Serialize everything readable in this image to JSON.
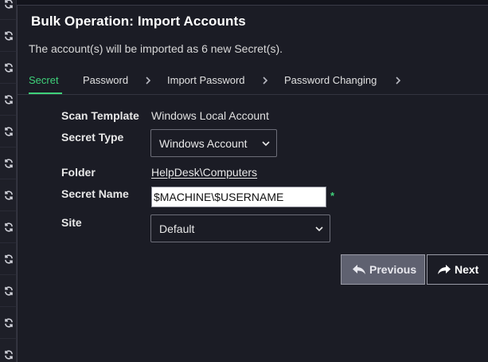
{
  "dialog": {
    "title": "Bulk Operation: Import Accounts",
    "subtitle": "The account(s) will be imported as 6 new Secret(s)."
  },
  "tabs": [
    {
      "label": "Secret",
      "active": true
    },
    {
      "label": "Password",
      "active": false
    },
    {
      "label": "Import Password",
      "active": false
    },
    {
      "label": "Password Changing",
      "active": false
    }
  ],
  "form": {
    "scan_template": {
      "label": "Scan Template",
      "value": "Windows Local Account"
    },
    "secret_type": {
      "label": "Secret Type",
      "selected": "Windows Account"
    },
    "folder": {
      "label": "Folder",
      "value": "HelpDesk\\Computers"
    },
    "secret_name": {
      "label": "Secret Name",
      "value": "$MACHINE\\$USERNAME",
      "required_marker": "*"
    },
    "site": {
      "label": "Site",
      "selected": "Default"
    }
  },
  "buttons": {
    "previous_label": "Previous",
    "next_label": "Next"
  },
  "rail": {
    "icon": "refresh-icon"
  },
  "colors": {
    "accent": "#3fd17a",
    "background": "#1b1c25",
    "previous_button": "#5f6170"
  }
}
